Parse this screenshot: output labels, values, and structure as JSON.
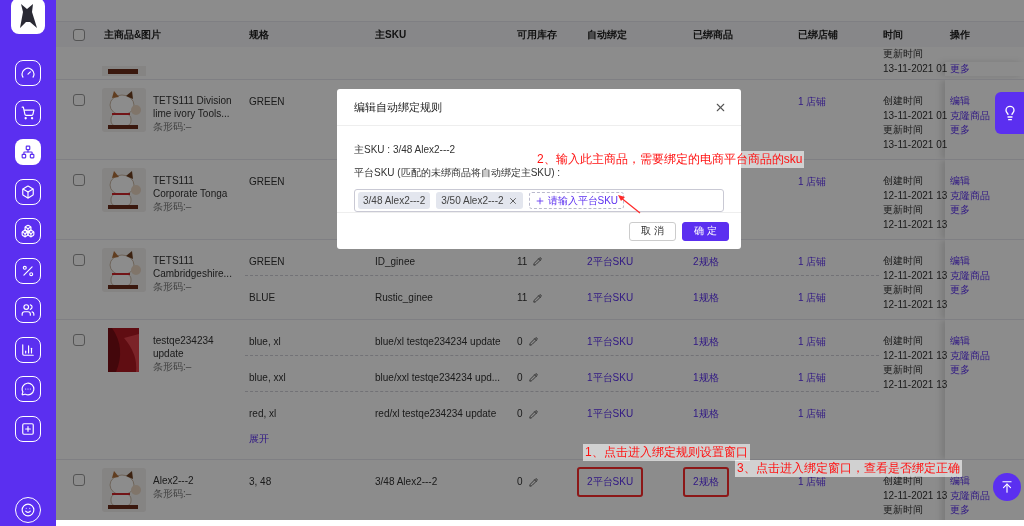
{
  "sidebar": {
    "items": [
      {
        "selected": false
      },
      {
        "selected": false
      },
      {
        "selected": true
      },
      {
        "selected": false
      },
      {
        "selected": false
      },
      {
        "selected": false
      },
      {
        "selected": false
      },
      {
        "selected": false
      },
      {
        "selected": false
      },
      {
        "selected": false
      },
      {
        "selected": false
      }
    ]
  },
  "table": {
    "header_checkbox": {
      "checked": false
    },
    "columns": [
      "主商品&图片",
      "规格",
      "主SKU",
      "可用库存",
      "自动绑定",
      "已绑商品",
      "已绑店铺",
      "时间",
      "操作"
    ],
    "partial_row": {
      "time": [
        "更新时间",
        "13-11-2021 01"
      ],
      "actions": [
        "更多"
      ]
    },
    "rows": [
      {
        "checked": false,
        "image": {
          "kind": "picture"
        },
        "name": [
          "TETS111 Division",
          "lime ivory Tools..."
        ],
        "barcode": "条形码:–",
        "variants": [
          {
            "spec": "GREEN",
            "store": "1 店铺"
          }
        ],
        "time": [
          "创建时间",
          "13-11-2021 01",
          "更新时间",
          "13-11-2021 01"
        ],
        "actions": [
          "编辑",
          "克隆商品",
          "更多"
        ]
      },
      {
        "checked": false,
        "image": {
          "kind": "picture"
        },
        "name": [
          "TETS111",
          "Corporate Tonga"
        ],
        "barcode": "条形码:–",
        "variants": [
          {
            "spec": "GREEN",
            "store": "1 店铺"
          }
        ],
        "time": [
          "创建时间",
          "12-11-2021 13",
          "更新时间",
          "12-11-2021 13"
        ],
        "actions": [
          "编辑",
          "克隆商品",
          "更多"
        ]
      },
      {
        "checked": false,
        "image": {
          "kind": "picture"
        },
        "name": [
          "TETS111",
          "Cambridgeshire..."
        ],
        "barcode": "条形码:–",
        "variants": [
          {
            "spec": "GREEN",
            "sku": "ID_ginee",
            "stock": "11",
            "auto": {
              "text": "2平台SKU",
              "boxed": false
            },
            "bound": {
              "text": "2规格",
              "boxed": false
            },
            "store": "1 店铺"
          },
          {
            "spec": "BLUE",
            "sku": "Rustic_ginee",
            "stock": "11",
            "auto": {
              "text": "1平台SKU",
              "boxed": false
            },
            "bound": {
              "text": "1规格",
              "boxed": false
            },
            "store": "1 店铺"
          }
        ],
        "time": [
          "创建时间",
          "12-11-2021 13",
          "更新时间",
          "12-11-2021 13"
        ],
        "actions": [
          "编辑",
          "克隆商品",
          "更多"
        ]
      },
      {
        "checked": false,
        "image": {
          "kind": "picture"
        },
        "name": [
          "testqe234234",
          "update"
        ],
        "barcode": "条形码:–",
        "variants": [
          {
            "spec": "blue, xl",
            "sku": "blue/xl testqe234234 update",
            "stock": "0",
            "auto": {
              "text": "1平台SKU",
              "boxed": false
            },
            "bound": {
              "text": "1规格",
              "boxed": false
            },
            "store": "1 店铺"
          },
          {
            "spec": "blue, xxl",
            "sku": "blue/xxl testqe234234 upd...",
            "stock": "0",
            "auto": {
              "text": "1平台SKU",
              "boxed": false
            },
            "bound": {
              "text": "1规格",
              "boxed": false
            },
            "store": "1 店铺"
          },
          {
            "spec": "red, xl",
            "sku": "red/xl testqe234234 update",
            "stock": "0",
            "auto": {
              "text": "1平台SKU",
              "boxed": false
            },
            "bound": {
              "text": "1规格",
              "boxed": false
            },
            "store": "1 店铺"
          }
        ],
        "expand": "展开",
        "time": [
          "创建时间",
          "12-11-2021 13",
          "更新时间",
          "12-11-2021 13"
        ],
        "actions": [
          "编辑",
          "克隆商品",
          "更多"
        ]
      },
      {
        "checked": false,
        "image": {
          "kind": "picture"
        },
        "name": [
          "Alex2---2"
        ],
        "barcode": "条形码:–",
        "variants": [
          {
            "spec": "3, 48",
            "sku": "3/48 Alex2---2",
            "stock": "0",
            "auto": {
              "text": "2平台SKU",
              "boxed": true
            },
            "bound": {
              "text": "2规格",
              "boxed": true
            },
            "store": "1 店铺"
          }
        ],
        "time": [
          "创建时间",
          "12-11-2021 13",
          "更新时间"
        ],
        "actions": [
          "编辑",
          "克隆商品",
          "更多"
        ]
      }
    ]
  },
  "modal": {
    "title": "编辑自动绑定规则",
    "main_sku": "主SKU : 3/48 Alex2---2",
    "field_label": "平台SKU (匹配的未绑商品将自动绑定主SKU) :",
    "tags": [
      {
        "text": "3/48 Alex2---2",
        "removable": false
      },
      {
        "text": "3/50 Alex2---2",
        "removable": true
      }
    ],
    "add_placeholder": "请输入平台SKU",
    "buttons": [
      {
        "text": "取 消",
        "kind": "secondary"
      },
      {
        "text": "确 定",
        "kind": "primary"
      }
    ]
  },
  "annotations": [
    {
      "kind": "note",
      "text": "2、输入此主商品，需要绑定的电商平台商品的sku"
    },
    {
      "kind": "note",
      "text": "1、点击进入绑定规则设置窗口"
    },
    {
      "kind": "note",
      "text": "3、点击进入绑定窗口，查看是否绑定正确"
    }
  ]
}
